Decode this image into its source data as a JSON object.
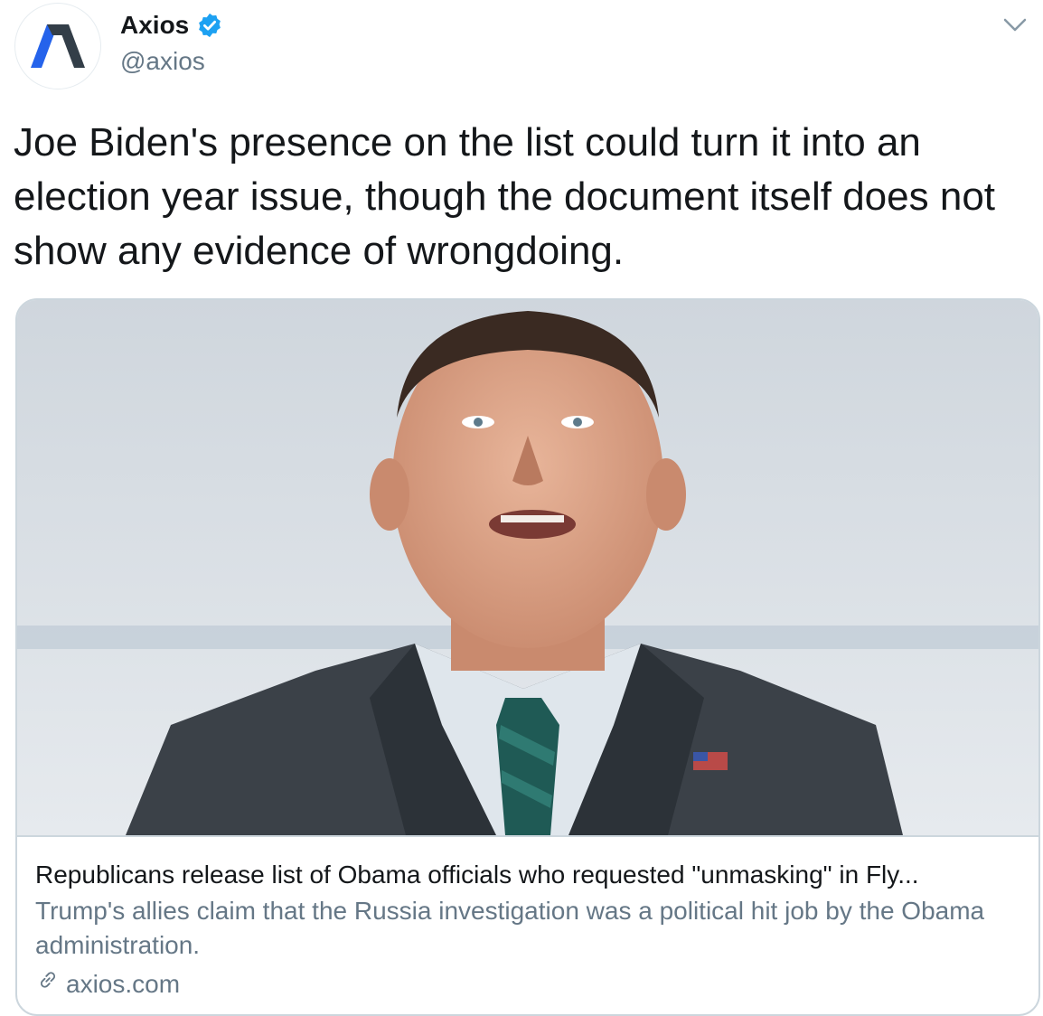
{
  "author": {
    "name": "Axios",
    "handle": "@axios",
    "verified": true,
    "avatar_icon": "axios-logo-icon"
  },
  "tweet": {
    "text": "Joe Biden's presence on the list could turn it into an election year issue, though the document itself does not show any evidence of wrongdoing."
  },
  "card": {
    "image_icon": "article-photo",
    "title": "Republicans release list of Obama officials who requested \"unmasking\" in Fly...",
    "description": "Trump's allies claim that the Russia investigation was a political hit job by the Obama administration.",
    "domain": "axios.com",
    "domain_icon": "link-icon"
  },
  "menu": {
    "icon": "chevron-down-icon"
  },
  "colors": {
    "text_primary": "#14171a",
    "text_secondary": "#657786",
    "border": "#ccd6dd",
    "verified_blue": "#1da1f2",
    "logo_dark": "#333e48",
    "logo_blue": "#2563eb"
  }
}
